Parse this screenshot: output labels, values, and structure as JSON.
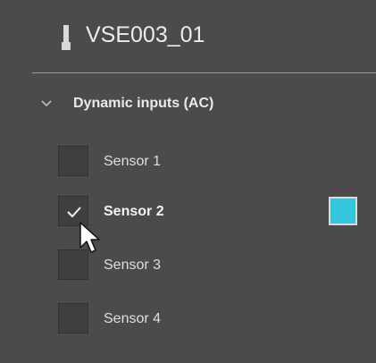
{
  "device": {
    "name": "VSE003_01",
    "icon": "device-icon"
  },
  "group": {
    "title": "Dynamic inputs (AC)",
    "icon": "chevron-down-icon",
    "expanded": true
  },
  "sensors": [
    {
      "label": "Sensor 1",
      "checked": false
    },
    {
      "label": "Sensor 2",
      "checked": true,
      "color": "#33c6dd"
    },
    {
      "label": "Sensor 3",
      "checked": false
    },
    {
      "label": "Sensor 4",
      "checked": false
    }
  ],
  "colors": {
    "background": "#4b4b4b",
    "checkbox": "#3f3f3f",
    "accent": "#33c6dd"
  }
}
